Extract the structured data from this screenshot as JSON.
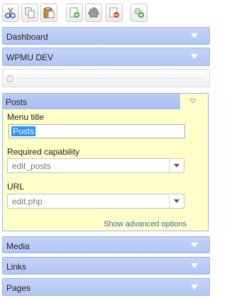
{
  "toolbar": {
    "buttons": [
      {
        "name": "cut-icon"
      },
      {
        "name": "copy-icon"
      },
      {
        "name": "paste-icon"
      },
      {
        "name": "new-menu-icon"
      },
      {
        "name": "new-item-icon"
      },
      {
        "name": "delete-icon"
      },
      {
        "name": "add-separator-icon"
      }
    ]
  },
  "menus": {
    "dashboard": "Dashboard",
    "wpmu_dev": "WPMU DEV",
    "media": "Media",
    "links": "Links",
    "pages": "Pages"
  },
  "posts_panel": {
    "title": "Posts",
    "menu_title_label": "Menu title",
    "menu_title_value": "Posts",
    "capability_label": "Required capability",
    "capability_value": "edit_posts",
    "url_label": "URL",
    "url_value": "edit.php",
    "advanced_link": "Show advanced options"
  },
  "colors": {
    "bar_blue": "#b8cbf5",
    "panel_yellow": "#fffec8",
    "link_blue": "#2f6fb7",
    "selection_blue": "#3391ff"
  }
}
